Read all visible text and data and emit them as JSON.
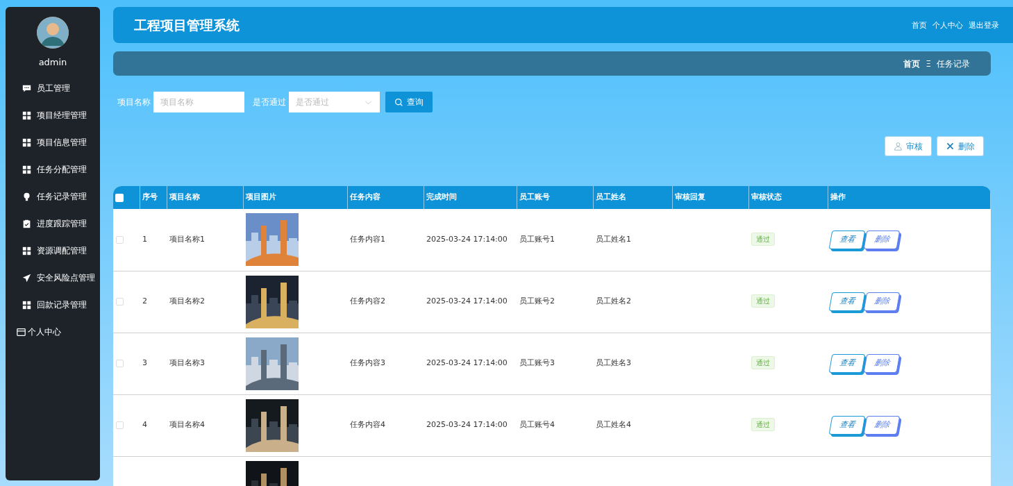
{
  "sidebar": {
    "username": "admin",
    "items": [
      {
        "label": "员工管理",
        "kind": "chat"
      },
      {
        "label": "项目经理管理",
        "kind": "grid"
      },
      {
        "label": "项目信息管理",
        "kind": "grid"
      },
      {
        "label": "任务分配管理",
        "kind": "grid"
      },
      {
        "label": "任务记录管理",
        "kind": "bulb"
      },
      {
        "label": "进度跟踪管理",
        "kind": "clipboard"
      },
      {
        "label": "资源调配管理",
        "kind": "grid"
      },
      {
        "label": "安全风险点管理",
        "kind": "plane"
      },
      {
        "label": "回款记录管理",
        "kind": "grid"
      },
      {
        "label": "个人中心",
        "kind": "card"
      }
    ]
  },
  "header": {
    "title": "工程项目管理系统",
    "links": [
      "首页",
      "个人中心",
      "退出登录"
    ]
  },
  "breadcrumb": {
    "home": "首页",
    "separator": "Ξ",
    "current": "任务记录"
  },
  "search": {
    "fields": [
      {
        "label": "项目名称",
        "placeholder": "项目名称",
        "kind": "text"
      },
      {
        "label": "是否通过",
        "placeholder": "是否通过",
        "kind": "select"
      }
    ],
    "button": "查询"
  },
  "toolbar": [
    {
      "label": "审核",
      "kind": "audit"
    },
    {
      "label": "删除",
      "kind": "delete"
    }
  ],
  "table": {
    "select_all": {
      "checked": false
    },
    "columns": [
      "序号",
      "项目名称",
      "项目图片",
      "任务内容",
      "完成时间",
      "员工账号",
      "员工姓名",
      "审核回复",
      "审核状态",
      "操作"
    ],
    "rows": [
      {
        "checked": false,
        "index": "1",
        "project": "项目名称1",
        "task": "任务内容1",
        "time": "2025-03-24 17:14:00",
        "account": "员工账号1",
        "name": "员工姓名1",
        "status": "通过",
        "actions": [
          "查看",
          "删除"
        ]
      },
      {
        "checked": false,
        "index": "2",
        "project": "项目名称2",
        "task": "任务内容2",
        "time": "2025-03-24 17:14:00",
        "account": "员工账号2",
        "name": "员工姓名2",
        "status": "通过",
        "actions": [
          "查看",
          "删除"
        ]
      },
      {
        "checked": false,
        "index": "3",
        "project": "项目名称3",
        "task": "任务内容3",
        "time": "2025-03-24 17:14:00",
        "account": "员工账号3",
        "name": "员工姓名3",
        "status": "通过",
        "actions": [
          "查看",
          "删除"
        ]
      },
      {
        "checked": false,
        "index": "4",
        "project": "项目名称4",
        "task": "任务内容4",
        "time": "2025-03-24 17:14:00",
        "account": "员工账号4",
        "name": "员工姓名4",
        "status": "通过",
        "actions": [
          "查看",
          "删除"
        ]
      }
    ],
    "row_cut_at_edge": true
  }
}
